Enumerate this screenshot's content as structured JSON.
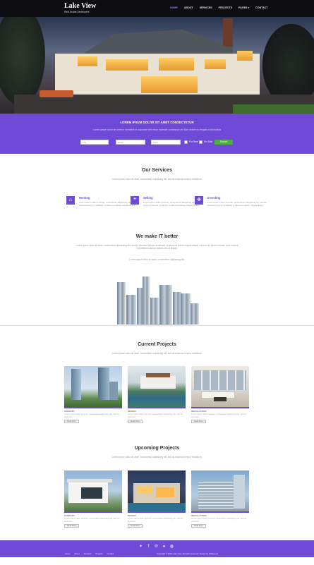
{
  "header": {
    "logo": "Lake View",
    "tagline": "Real Estate Developers",
    "nav": [
      "HOME",
      "ABOUT",
      "SERVICES",
      "PROJECTS",
      "PAGES ▾",
      "CONTACT"
    ]
  },
  "search": {
    "title": "LOREM IPSUM DOLOR SIT AMET CONSECTETUR",
    "subtitle": "Lorem ipsum dolor sit amet in hendrerit in vulputate velit esse molestie consequat vel illum dolore eu feugiat nulla facilisis",
    "fields": [
      "City",
      "Room",
      "Type"
    ],
    "checks": [
      "For Rent",
      "For Sale"
    ],
    "button": "Search"
  },
  "services": {
    "title": "Our Services",
    "subtitle": "Lorem ipsum dolor sit amet, consectetur adipisicing elit, sed do eiusmod tempor incididunt.",
    "items": [
      {
        "name": "Renting",
        "icon": "home-icon",
        "desc": "Lorem ipsum dolor sit amet, consectetur adipisicing elit, sed do eiusmod tempor incididunt ut labore et dolore magna aliqua."
      },
      {
        "name": "Selling",
        "icon": "quote-icon",
        "desc": "Lorem ipsum dolor sit amet, consectetur adipisicing elit, sed do eiusmod tempor incididunt ut labore et dolore magna aliqua."
      },
      {
        "name": "Investing",
        "icon": "arrows-icon",
        "desc": "Lorem ipsum dolor sit amet, consectetur adipisicing elit, sed do eiusmod tempor incididunt ut labore et dolore magna aliqua."
      }
    ]
  },
  "about": {
    "title": "We make IT better",
    "subtitle": "Lorem ipsum dolor sit amet, consectetur adipisicing elit, sed do eiusmod tempor incididunt ut labore et dolore magna aliqua. Ut enim ad minim veniam, quis nostrud exercitation ullamco laboris nisi ut aliquip.",
    "subtitle2": "Lorem ipsum dolor sit amet, consectetur adipisicing elit."
  },
  "current": {
    "title": "Current Projects",
    "subtitle": "Lorem ipsum dolor sit amet, consectetur adipisicing elit, sed do eiusmod tempor incididunt.",
    "cards": [
      {
        "label": "CONCEPT",
        "desc": "Lorem ipsum dolor sit amet, consectetur adipisicing elit, sed do eiusmod.",
        "more": "Read More"
      },
      {
        "label": "DESIGN",
        "desc": "Lorem ipsum dolor sit amet, consectetur adipisicing elit, sed do eiusmod.",
        "more": "Read More"
      },
      {
        "label": "INSTALLATION",
        "desc": "Lorem ipsum dolor sit amet, consectetur adipisicing elit, sed do eiusmod.",
        "more": "Read More"
      }
    ]
  },
  "upcoming": {
    "title": "Upcoming Projects",
    "subtitle": "Lorem ipsum dolor sit amet, consectetur adipisicing elit, sed do eiusmod tempor incididunt.",
    "cards": [
      {
        "label": "CONCEPT",
        "desc": "Lorem ipsum dolor sit amet, consectetur adipisicing elit, sed do eiusmod.",
        "more": "Read More"
      },
      {
        "label": "DESIGN",
        "desc": "Lorem ipsum dolor sit amet, consectetur adipisicing elit, sed do eiusmod.",
        "more": "Read More"
      },
      {
        "label": "INSTALLATION",
        "desc": "Lorem ipsum dolor sit amet, consectetur adipisicing elit, sed do eiusmod.",
        "more": "Read More"
      }
    ]
  },
  "footer": {
    "links": [
      "Home",
      "About",
      "Services",
      "Projects",
      "Contact"
    ],
    "copyright": "Copyright © 2016 Lake View. All rights reserved. Design by W3layouts",
    "social_icons": [
      "twitter-icon",
      "facebook-icon",
      "pinterest-icon",
      "flickr-icon",
      "github-icon"
    ]
  },
  "colors": {
    "accent": "#6f4ad6",
    "button": "#4caf3f",
    "topbar": "#0d0d12"
  }
}
